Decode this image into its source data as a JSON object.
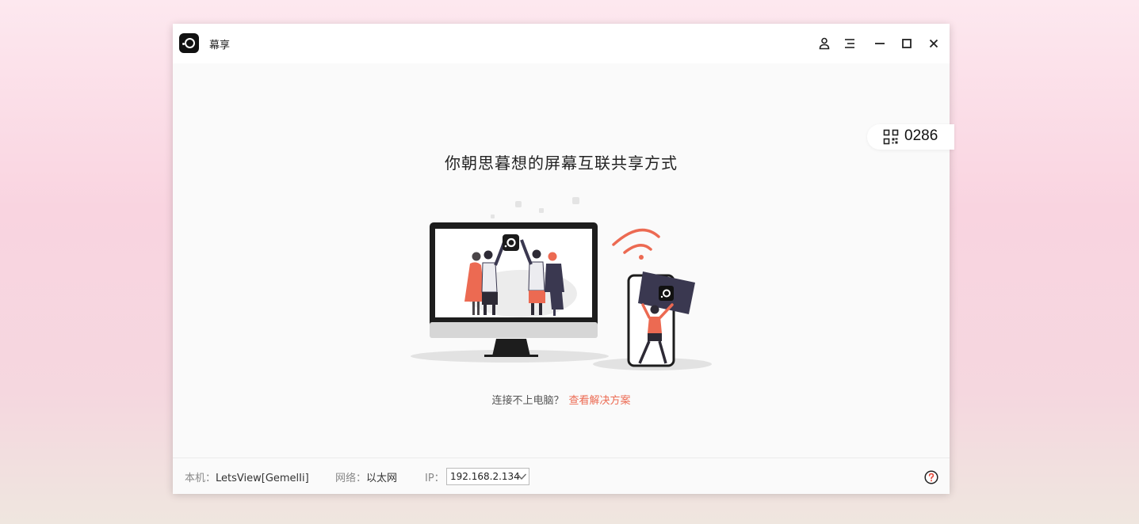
{
  "app": {
    "title": "幕享",
    "device_code": "0286"
  },
  "titlebar": {
    "icons": [
      "user-icon",
      "menu-icon",
      "minimize-icon",
      "maximize-icon",
      "close-icon"
    ]
  },
  "main": {
    "headline": "你朝思暮想的屏幕互联共享方式",
    "help_text": "连接不上电脑？",
    "help_link": "查看解决方案"
  },
  "statusbar": {
    "host_label": "本机：",
    "host_value": "LetsView[GemelIi]",
    "network_label": "网络：",
    "network_value": "以太网",
    "ip_label": "IP：",
    "ip_value": "192.168.2.134"
  },
  "colors": {
    "accent": "#ec6a52",
    "dark": "#1a1a1a",
    "navy": "#3a3850"
  }
}
